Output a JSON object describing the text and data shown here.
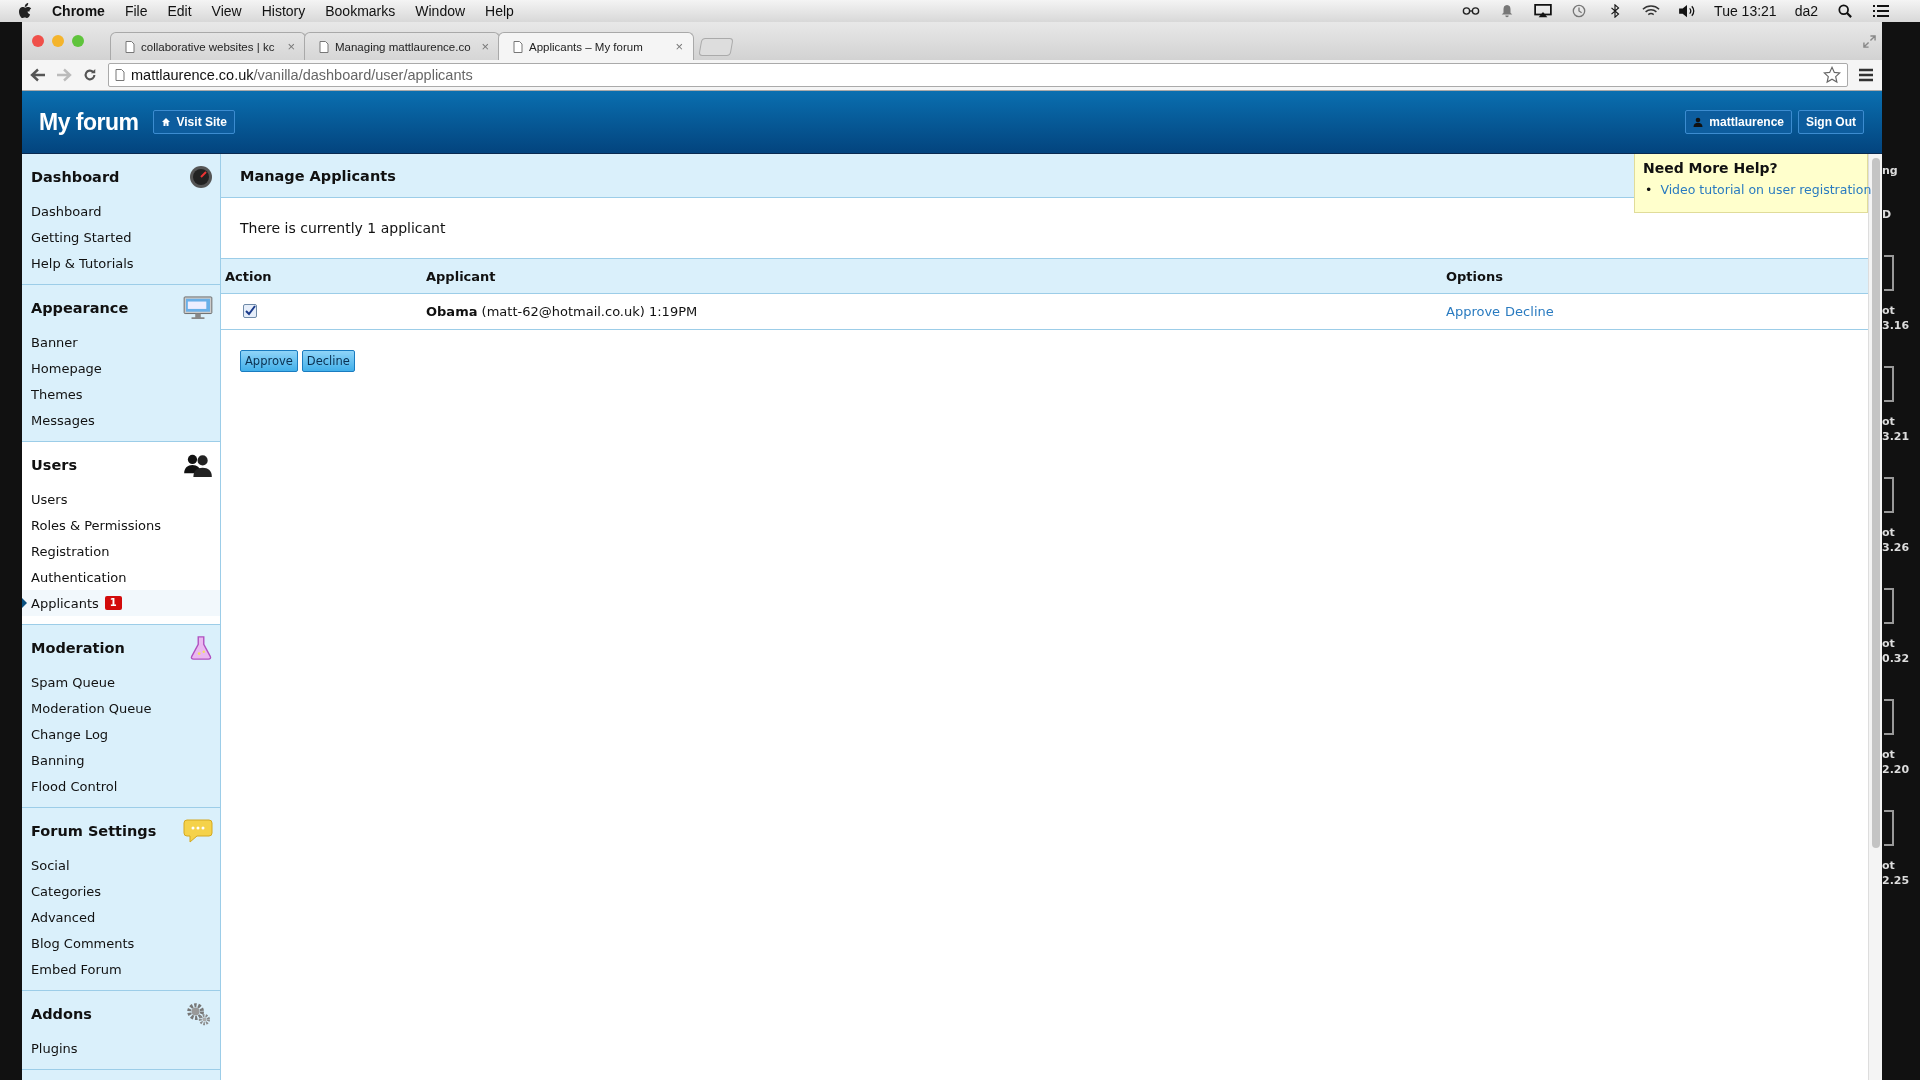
{
  "menubar": {
    "app": "Chrome",
    "menus": [
      "File",
      "Edit",
      "View",
      "History",
      "Bookmarks",
      "Window",
      "Help"
    ],
    "clock": "Tue 13:21",
    "user": "da2"
  },
  "tabs": [
    {
      "title": "collaborative websites | kc",
      "selected": false,
      "close": "×"
    },
    {
      "title": "Managing mattlaurence.co",
      "selected": false,
      "close": "×"
    },
    {
      "title": "Applicants – My forum",
      "selected": true,
      "close": "×"
    }
  ],
  "address_bar": {
    "domain": "mattlaurence.co.uk",
    "path": "/vanilla/dashboard/user/applicants"
  },
  "header": {
    "title": "My forum",
    "visit_site": "Visit Site",
    "user": "mattlaurence",
    "sign_out": "Sign Out"
  },
  "sidebar": {
    "sections": [
      {
        "title": "Dashboard",
        "selected": false,
        "items": [
          {
            "label": "Dashboard",
            "selected": false
          },
          {
            "label": "Getting Started",
            "selected": false
          },
          {
            "label": "Help & Tutorials",
            "selected": false
          }
        ]
      },
      {
        "title": "Appearance",
        "selected": false,
        "items": [
          {
            "label": "Banner",
            "selected": false
          },
          {
            "label": "Homepage",
            "selected": false
          },
          {
            "label": "Themes",
            "selected": false
          },
          {
            "label": "Messages",
            "selected": false
          }
        ]
      },
      {
        "title": "Users",
        "selected": true,
        "items": [
          {
            "label": "Users",
            "selected": false
          },
          {
            "label": "Roles & Permissions",
            "selected": false
          },
          {
            "label": "Registration",
            "selected": false
          },
          {
            "label": "Authentication",
            "selected": false
          },
          {
            "label": "Applicants",
            "selected": true,
            "badge": "1"
          }
        ]
      },
      {
        "title": "Moderation",
        "selected": false,
        "items": [
          {
            "label": "Spam Queue",
            "selected": false
          },
          {
            "label": "Moderation Queue",
            "selected": false
          },
          {
            "label": "Change Log",
            "selected": false
          },
          {
            "label": "Banning",
            "selected": false
          },
          {
            "label": "Flood Control",
            "selected": false
          }
        ]
      },
      {
        "title": "Forum Settings",
        "selected": false,
        "items": [
          {
            "label": "Social",
            "selected": false
          },
          {
            "label": "Categories",
            "selected": false
          },
          {
            "label": "Advanced",
            "selected": false
          },
          {
            "label": "Blog Comments",
            "selected": false
          },
          {
            "label": "Embed Forum",
            "selected": false
          }
        ]
      },
      {
        "title": "Addons",
        "selected": false,
        "items": [
          {
            "label": "Plugins",
            "selected": false
          }
        ]
      }
    ]
  },
  "main": {
    "title": "Manage Applicants",
    "summary": "There is currently 1 applicant",
    "table": {
      "columns": [
        "Action",
        "Applicant",
        "Options"
      ],
      "rows": [
        {
          "checked": true,
          "applicant": "**Obama** (matt-62@hotmail.co.uk) 1:19PM",
          "options": [
            "Approve",
            "Decline"
          ]
        }
      ]
    },
    "buttons": [
      "Approve",
      "Decline"
    ]
  },
  "help": {
    "title": "Need More Help?",
    "links": [
      {
        "marker": "•",
        "text": "Video tutorial on user registration"
      }
    ]
  },
  "desktop": {
    "labels": [
      {
        "kind": "text",
        "lines": [
          "ng"
        ]
      },
      {
        "kind": "text",
        "lines": [
          "D"
        ]
      },
      {
        "kind": "file",
        "lines": [
          "ot",
          "3.16"
        ]
      },
      {
        "kind": "file",
        "lines": [
          "ot",
          "3.21"
        ]
      },
      {
        "kind": "file",
        "lines": [
          "ot",
          "3.26"
        ]
      },
      {
        "kind": "file",
        "lines": [
          "ot",
          "0.32"
        ]
      },
      {
        "kind": "file",
        "lines": [
          "ot",
          "2.20"
        ]
      },
      {
        "kind": "file",
        "lines": [
          "ot",
          "2.25"
        ]
      }
    ]
  }
}
